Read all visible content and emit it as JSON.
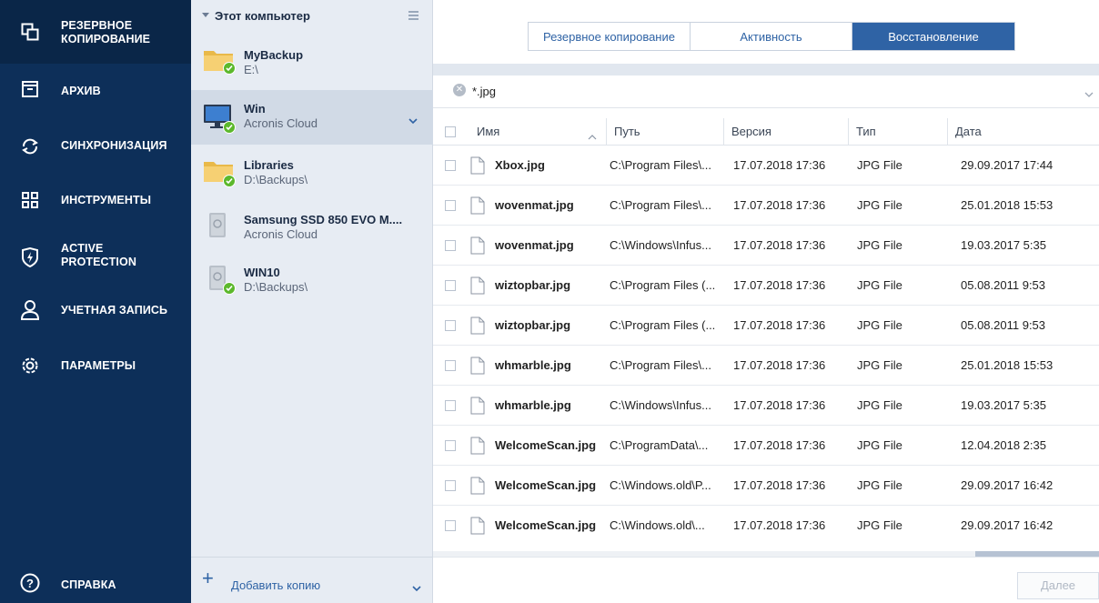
{
  "nav": {
    "items": [
      {
        "label": "РЕЗЕРВНОЕ\nКОПИРОВАНИЕ",
        "icon": "copy-icon",
        "active": true
      },
      {
        "label": "АРХИВ",
        "icon": "archive-icon"
      },
      {
        "label": "СИНХРОНИЗАЦИЯ",
        "icon": "sync-icon"
      },
      {
        "label": "ИНСТРУМЕНТЫ",
        "icon": "tools-grid-icon"
      },
      {
        "label": "ACTIVE\nPROTECTION",
        "icon": "shield-icon"
      },
      {
        "label": "УЧЕТНАЯ ЗАПИСЬ",
        "icon": "user-icon"
      },
      {
        "label": "ПАРАМЕТРЫ",
        "icon": "gear-icon"
      }
    ],
    "help_label": "СПРАВКА",
    "help_icon": "help-icon"
  },
  "backups": {
    "header": "Этот компьютер",
    "items": [
      {
        "name": "MyBackup",
        "sub": "E:\\",
        "icon": "folder-icon",
        "status": "ok"
      },
      {
        "name": "Win",
        "sub": "Acronis Cloud",
        "icon": "monitor-icon",
        "status": "ok",
        "selected": true
      },
      {
        "name": "Libraries",
        "sub": "D:\\Backups\\",
        "icon": "folder-icon",
        "status": "ok"
      },
      {
        "name": "Samsung SSD 850 EVO M....",
        "sub": "Acronis Cloud",
        "icon": "disk-icon",
        "status": "none"
      },
      {
        "name": "WIN10",
        "sub": "D:\\Backups\\",
        "icon": "disk-icon",
        "status": "ok"
      }
    ],
    "add_label": "Добавить копию"
  },
  "tabs": [
    {
      "label": "Резервное копирование",
      "active": false
    },
    {
      "label": "Активность",
      "active": false
    },
    {
      "label": "Восстановление",
      "active": true
    }
  ],
  "search": {
    "value": "*.jpg"
  },
  "table": {
    "columns": [
      "Имя",
      "Путь",
      "Версия",
      "Тип",
      "Дата"
    ],
    "rows": [
      {
        "name": "Xbox.jpg",
        "path": "C:\\Program Files\\...",
        "version": "17.07.2018 17:36",
        "type": "JPG File",
        "date": "29.09.2017 17:44"
      },
      {
        "name": "wovenmat.jpg",
        "path": "C:\\Program Files\\...",
        "version": "17.07.2018 17:36",
        "type": "JPG File",
        "date": "25.01.2018 15:53"
      },
      {
        "name": "wovenmat.jpg",
        "path": "C:\\Windows\\Infus...",
        "version": "17.07.2018 17:36",
        "type": "JPG File",
        "date": "19.03.2017 5:35"
      },
      {
        "name": "wiztopbar.jpg",
        "path": "C:\\Program Files (...",
        "version": "17.07.2018 17:36",
        "type": "JPG File",
        "date": "05.08.2011 9:53"
      },
      {
        "name": "wiztopbar.jpg",
        "path": "C:\\Program Files (...",
        "version": "17.07.2018 17:36",
        "type": "JPG File",
        "date": "05.08.2011 9:53"
      },
      {
        "name": "whmarble.jpg",
        "path": "C:\\Program Files\\...",
        "version": "17.07.2018 17:36",
        "type": "JPG File",
        "date": "25.01.2018 15:53"
      },
      {
        "name": "whmarble.jpg",
        "path": "C:\\Windows\\Infus...",
        "version": "17.07.2018 17:36",
        "type": "JPG File",
        "date": "19.03.2017 5:35"
      },
      {
        "name": "WelcomeScan.jpg",
        "path": "C:\\ProgramData\\...",
        "version": "17.07.2018 17:36",
        "type": "JPG File",
        "date": "12.04.2018 2:35"
      },
      {
        "name": "WelcomeScan.jpg",
        "path": "C:\\Windows.old\\P...",
        "version": "17.07.2018 17:36",
        "type": "JPG File",
        "date": "29.09.2017 16:42"
      },
      {
        "name": "WelcomeScan.jpg",
        "path": "C:\\Windows.old\\...",
        "version": "17.07.2018 17:36",
        "type": "JPG File",
        "date": "29.09.2017 16:42"
      }
    ]
  },
  "footer": {
    "next_label": "Далее"
  },
  "colors": {
    "nav_bg": "#0d2f59",
    "accent": "#2f63a5",
    "success": "#5cb82c"
  }
}
